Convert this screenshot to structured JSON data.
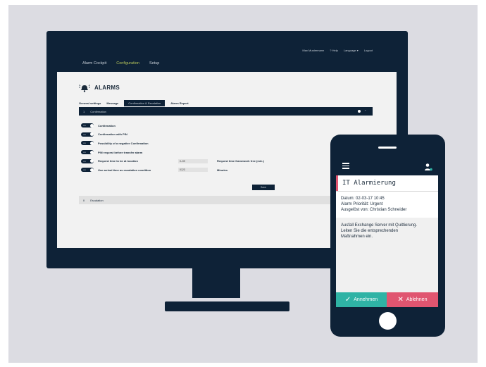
{
  "desktop": {
    "top_links": [
      "Max Mustermann",
      "? Help",
      "Language ▾",
      "Logout"
    ],
    "nav": [
      "Alarm Cockpit",
      "Configuration",
      "Setup"
    ],
    "page_title": "ALARMS",
    "subtabs": [
      "General settings",
      "Message",
      "Confirmation & Escalation",
      "Alarm Report"
    ],
    "section": {
      "num": "1",
      "label": "Confirmation"
    },
    "toggle_state": "on",
    "rows": [
      {
        "label": "Confirmation"
      },
      {
        "label": "Confirmation with PIN"
      },
      {
        "label": "Possibility of a negative Confirmation"
      },
      {
        "label": "PIN request before transfer alarm"
      },
      {
        "label": "Request time to be at location",
        "field": "0–99",
        "unit": "Request time framework free (min.)"
      },
      {
        "label": "Use arrival time as escalation condition",
        "field": "0123",
        "unit": "Minutes"
      }
    ],
    "save_label": "Save",
    "escalation": {
      "num": "II",
      "label": "Escalation"
    }
  },
  "phone": {
    "alarm_title": "IT Alarmierung",
    "info": [
      "Datum: 02-03-17 10:45",
      "Alarm Priorität: Urgent",
      "Ausgelöst von: Christian Schneider"
    ],
    "message": [
      "Ausfall Exchange Server mit Quittierung.",
      "Leiten Sie die entsprechenden",
      "Maßnahmen ein."
    ],
    "accept_label": "Annehmen",
    "reject_label": "Ablehnen",
    "accept_icon": "✓",
    "reject_icon": "✕"
  },
  "colors": {
    "navy": "#0e2237",
    "accent": "#b7c65a",
    "accept": "#2fb3a5",
    "reject": "#e05570"
  }
}
